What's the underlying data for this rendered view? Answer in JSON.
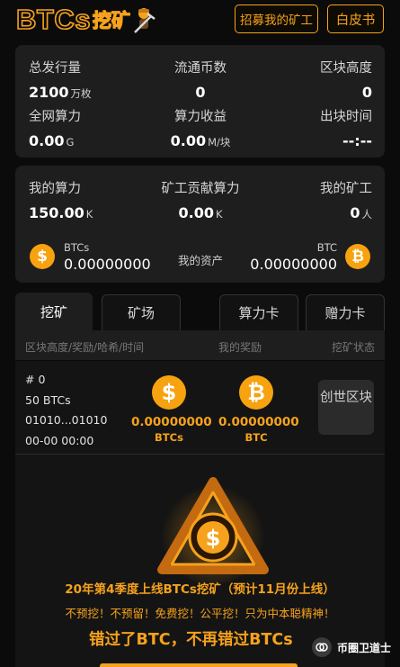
{
  "header": {
    "logo_text": "BTCs",
    "logo_cn": "挖矿",
    "recruit_label": "招募我的矿工",
    "whitepaper_label": "白皮书"
  },
  "network": {
    "total_issue": {
      "label": "总发行量",
      "value": "2100",
      "unit": "万枚"
    },
    "circulating": {
      "label": "流通币数",
      "value": "0"
    },
    "block_height": {
      "label": "区块高度",
      "value": "0"
    },
    "network_power": {
      "label": "全网算力",
      "value": "0.00",
      "unit": "G"
    },
    "power_income": {
      "label": "算力收益",
      "value": "0.00",
      "unit": "M/块"
    },
    "block_time": {
      "label": "出块时间",
      "value": "--:--"
    }
  },
  "mine": {
    "my_power": {
      "label": "我的算力",
      "value": "150.00",
      "unit": "K"
    },
    "miner_power": {
      "label": "矿工贡献算力",
      "value": "0.00",
      "unit": "K"
    },
    "my_miners": {
      "label": "我的矿工",
      "value": "0",
      "unit": "人"
    },
    "btcs_asset": {
      "label": "BTCs",
      "value": "0.00000000"
    },
    "assets_label": "我的资产",
    "btc_asset": {
      "label": "BTC",
      "value": "0.00000000"
    }
  },
  "tabs": [
    {
      "label": "挖矿",
      "active": true
    },
    {
      "label": "矿场",
      "active": false
    },
    {
      "label": "算力卡",
      "active": false
    },
    {
      "label": "赠力卡",
      "active": false
    }
  ],
  "columns": {
    "block_info": "区块高度/奖励/哈希/时间",
    "my_reward": "我的奖励",
    "status": "挖矿状态"
  },
  "block": {
    "height": "# 0",
    "reward": "50 BTCs",
    "hash": "01010...01010",
    "time": "00-00 00:00",
    "btcs_amount": "0.00000000",
    "btcs_unit": "BTCs",
    "btc_amount": "0.00000000",
    "btc_unit": "BTC",
    "status_label": "创世区块"
  },
  "promo": {
    "line1": "20年第4季度上线BTCs挖矿（预计11月份上线）",
    "line2": "不预挖！不预留！免费挖！公平挖！只为中本聪精神！",
    "line3": "错过了BTC，不再错过BTCs"
  },
  "watermark": {
    "label": "币圈卫道士"
  },
  "colors": {
    "accent": "#f6a21c",
    "card": "#1e1e1f",
    "bg": "#0b0b0b"
  }
}
